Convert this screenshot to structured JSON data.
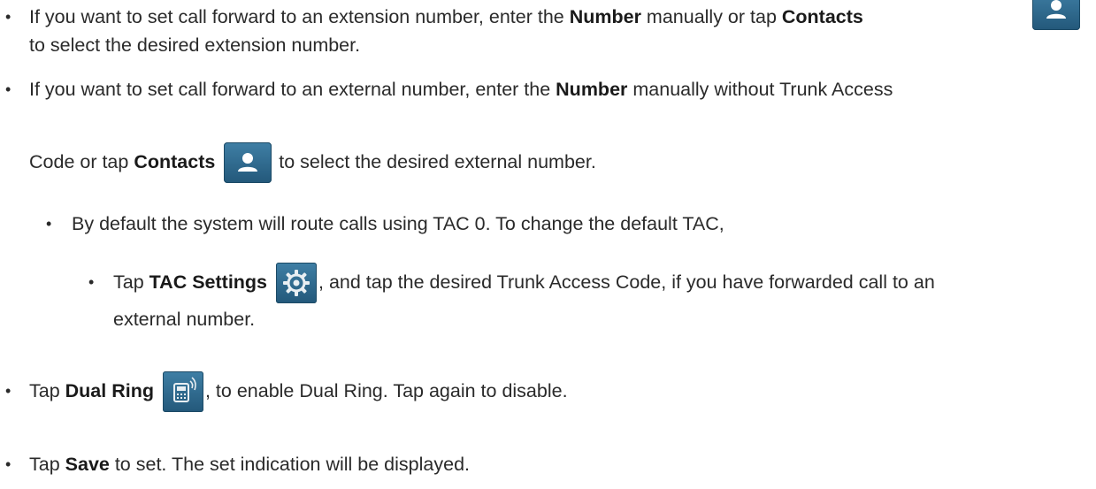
{
  "bullet": "•",
  "items": {
    "extension": {
      "text1": "If you want to set call forward to an extension number, enter the ",
      "number": "Number",
      "text2": " manually or tap ",
      "contacts": "Contacts",
      "text3": "to select the desired extension number."
    },
    "external": {
      "text1": "If you want to set call forward to an external number, enter the ",
      "number": "Number",
      "text2": " manually without Trunk Access",
      "text3": "Code or tap ",
      "contacts": "Contacts",
      "text4": " to select the desired external number."
    },
    "default_tac": {
      "text": "By default the system will route calls using TAC 0. To change the default TAC,"
    },
    "tac_settings": {
      "tap": "Tap ",
      "label": "TAC Settings",
      "text1": ", and tap the desired Trunk Access Code, if you have forwarded call to an",
      "text2": "external number."
    },
    "dual_ring": {
      "tap": "Tap ",
      "label": "Dual Ring",
      "text": ", to enable Dual Ring. Tap again to disable."
    },
    "save": {
      "tap": "Tap ",
      "label": "Save",
      "text": " to set. The set indication will be displayed."
    }
  },
  "icons": {
    "contacts": "contact-person-icon",
    "tac_settings": "gear-icon",
    "dual_ring": "dual-ring-phone-icon"
  },
  "colors": {
    "icon_top": "#3f7fa5",
    "icon_bottom": "#23587a",
    "text": "#2a2a2a"
  }
}
